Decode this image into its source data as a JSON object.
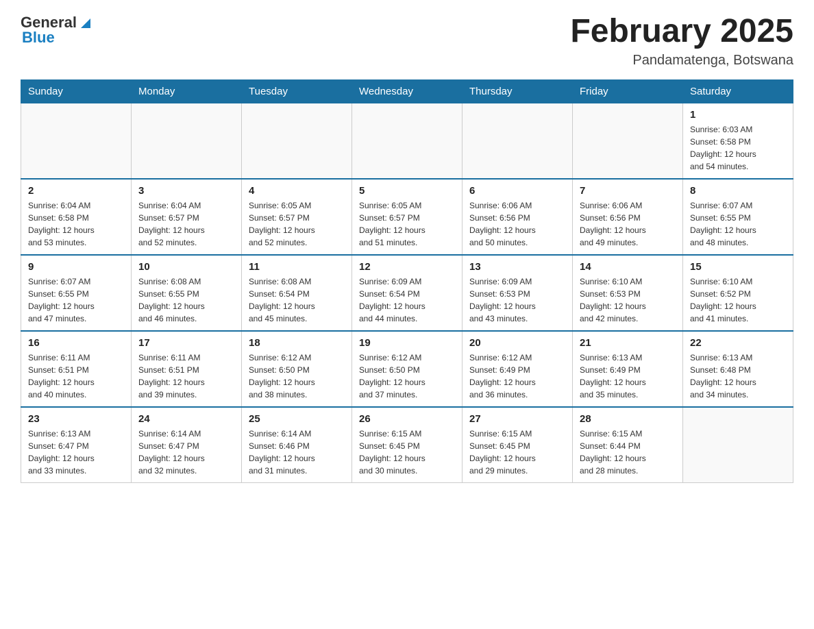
{
  "header": {
    "logo_general": "General",
    "logo_blue": "Blue",
    "month_year": "February 2025",
    "location": "Pandamatenga, Botswana"
  },
  "days_of_week": [
    "Sunday",
    "Monday",
    "Tuesday",
    "Wednesday",
    "Thursday",
    "Friday",
    "Saturday"
  ],
  "weeks": [
    [
      {
        "date": "",
        "info": ""
      },
      {
        "date": "",
        "info": ""
      },
      {
        "date": "",
        "info": ""
      },
      {
        "date": "",
        "info": ""
      },
      {
        "date": "",
        "info": ""
      },
      {
        "date": "",
        "info": ""
      },
      {
        "date": "1",
        "info": "Sunrise: 6:03 AM\nSunset: 6:58 PM\nDaylight: 12 hours\nand 54 minutes."
      }
    ],
    [
      {
        "date": "2",
        "info": "Sunrise: 6:04 AM\nSunset: 6:58 PM\nDaylight: 12 hours\nand 53 minutes."
      },
      {
        "date": "3",
        "info": "Sunrise: 6:04 AM\nSunset: 6:57 PM\nDaylight: 12 hours\nand 52 minutes."
      },
      {
        "date": "4",
        "info": "Sunrise: 6:05 AM\nSunset: 6:57 PM\nDaylight: 12 hours\nand 52 minutes."
      },
      {
        "date": "5",
        "info": "Sunrise: 6:05 AM\nSunset: 6:57 PM\nDaylight: 12 hours\nand 51 minutes."
      },
      {
        "date": "6",
        "info": "Sunrise: 6:06 AM\nSunset: 6:56 PM\nDaylight: 12 hours\nand 50 minutes."
      },
      {
        "date": "7",
        "info": "Sunrise: 6:06 AM\nSunset: 6:56 PM\nDaylight: 12 hours\nand 49 minutes."
      },
      {
        "date": "8",
        "info": "Sunrise: 6:07 AM\nSunset: 6:55 PM\nDaylight: 12 hours\nand 48 minutes."
      }
    ],
    [
      {
        "date": "9",
        "info": "Sunrise: 6:07 AM\nSunset: 6:55 PM\nDaylight: 12 hours\nand 47 minutes."
      },
      {
        "date": "10",
        "info": "Sunrise: 6:08 AM\nSunset: 6:55 PM\nDaylight: 12 hours\nand 46 minutes."
      },
      {
        "date": "11",
        "info": "Sunrise: 6:08 AM\nSunset: 6:54 PM\nDaylight: 12 hours\nand 45 minutes."
      },
      {
        "date": "12",
        "info": "Sunrise: 6:09 AM\nSunset: 6:54 PM\nDaylight: 12 hours\nand 44 minutes."
      },
      {
        "date": "13",
        "info": "Sunrise: 6:09 AM\nSunset: 6:53 PM\nDaylight: 12 hours\nand 43 minutes."
      },
      {
        "date": "14",
        "info": "Sunrise: 6:10 AM\nSunset: 6:53 PM\nDaylight: 12 hours\nand 42 minutes."
      },
      {
        "date": "15",
        "info": "Sunrise: 6:10 AM\nSunset: 6:52 PM\nDaylight: 12 hours\nand 41 minutes."
      }
    ],
    [
      {
        "date": "16",
        "info": "Sunrise: 6:11 AM\nSunset: 6:51 PM\nDaylight: 12 hours\nand 40 minutes."
      },
      {
        "date": "17",
        "info": "Sunrise: 6:11 AM\nSunset: 6:51 PM\nDaylight: 12 hours\nand 39 minutes."
      },
      {
        "date": "18",
        "info": "Sunrise: 6:12 AM\nSunset: 6:50 PM\nDaylight: 12 hours\nand 38 minutes."
      },
      {
        "date": "19",
        "info": "Sunrise: 6:12 AM\nSunset: 6:50 PM\nDaylight: 12 hours\nand 37 minutes."
      },
      {
        "date": "20",
        "info": "Sunrise: 6:12 AM\nSunset: 6:49 PM\nDaylight: 12 hours\nand 36 minutes."
      },
      {
        "date": "21",
        "info": "Sunrise: 6:13 AM\nSunset: 6:49 PM\nDaylight: 12 hours\nand 35 minutes."
      },
      {
        "date": "22",
        "info": "Sunrise: 6:13 AM\nSunset: 6:48 PM\nDaylight: 12 hours\nand 34 minutes."
      }
    ],
    [
      {
        "date": "23",
        "info": "Sunrise: 6:13 AM\nSunset: 6:47 PM\nDaylight: 12 hours\nand 33 minutes."
      },
      {
        "date": "24",
        "info": "Sunrise: 6:14 AM\nSunset: 6:47 PM\nDaylight: 12 hours\nand 32 minutes."
      },
      {
        "date": "25",
        "info": "Sunrise: 6:14 AM\nSunset: 6:46 PM\nDaylight: 12 hours\nand 31 minutes."
      },
      {
        "date": "26",
        "info": "Sunrise: 6:15 AM\nSunset: 6:45 PM\nDaylight: 12 hours\nand 30 minutes."
      },
      {
        "date": "27",
        "info": "Sunrise: 6:15 AM\nSunset: 6:45 PM\nDaylight: 12 hours\nand 29 minutes."
      },
      {
        "date": "28",
        "info": "Sunrise: 6:15 AM\nSunset: 6:44 PM\nDaylight: 12 hours\nand 28 minutes."
      },
      {
        "date": "",
        "info": ""
      }
    ]
  ]
}
